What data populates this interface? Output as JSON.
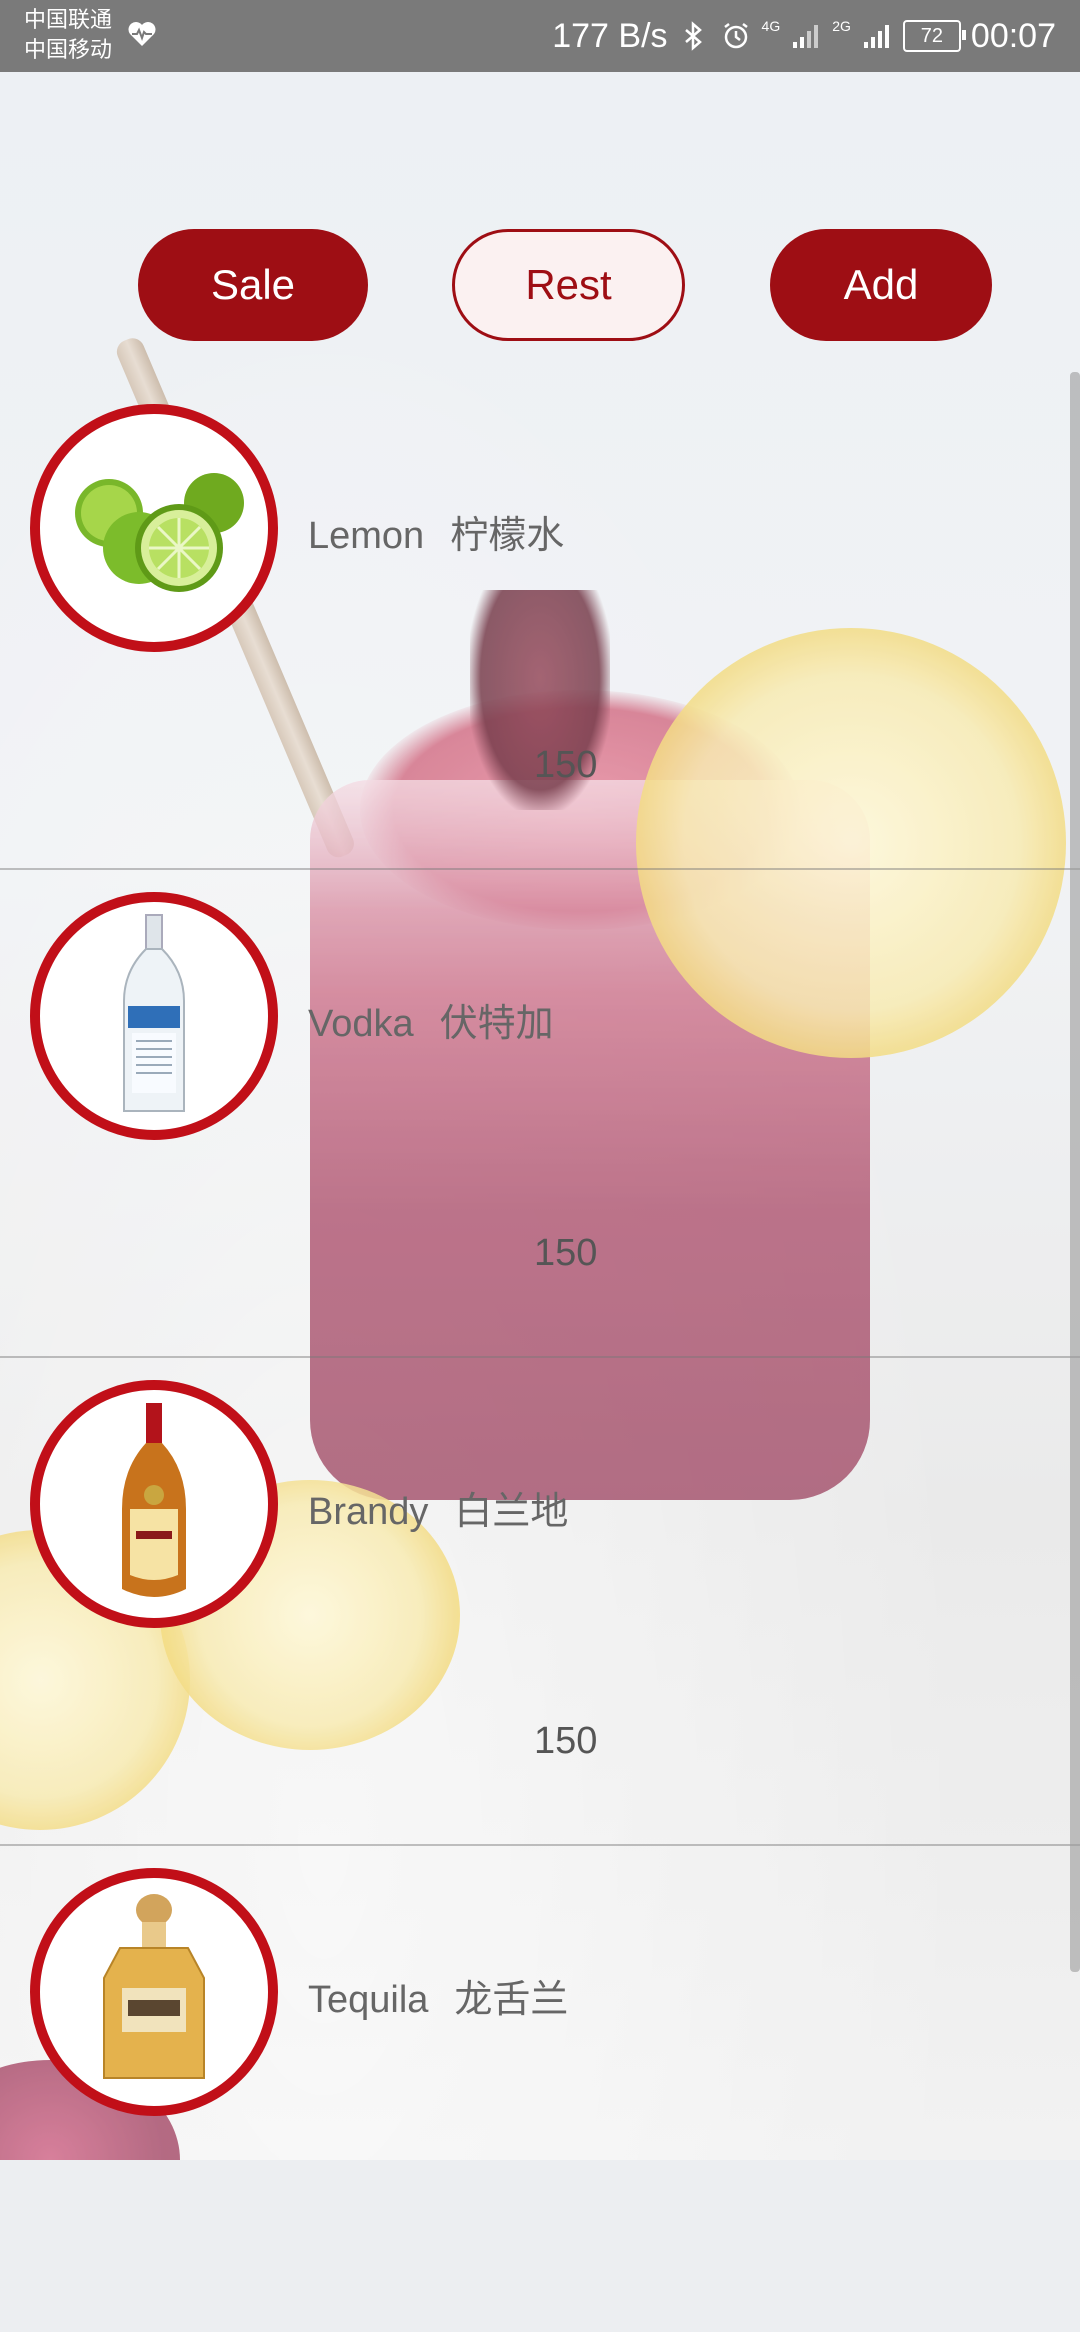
{
  "status_bar": {
    "carrier_1": "中国联通",
    "carrier_2": "中国移动",
    "net_speed": "177 B/s",
    "network_1": "4G",
    "network_2": "2G",
    "battery": "72",
    "time": "00:07",
    "icons": [
      "heart-rate-icon",
      "bluetooth-icon",
      "alarm-icon",
      "signal-icon",
      "battery-icon"
    ]
  },
  "actions": {
    "sale_label": "Sale",
    "rest_label": "Rest",
    "add_label": "Add"
  },
  "items": [
    {
      "name": "Lemon",
      "name_cn": "柠檬水",
      "price": "150",
      "icon": "lime-icon"
    },
    {
      "name": "Vodka",
      "name_cn": "伏特加",
      "price": "150",
      "icon": "vodka-bottle-icon"
    },
    {
      "name": "Brandy",
      "name_cn": "白兰地",
      "price": "150",
      "icon": "brandy-bottle-icon"
    },
    {
      "name": "Tequila",
      "name_cn": "龙舌兰",
      "price": "",
      "icon": "tequila-bottle-icon"
    }
  ],
  "colors": {
    "accent": "#9e0e14",
    "thumb_border": "#c10f18",
    "status_bar_bg": "#7a7a7a"
  }
}
